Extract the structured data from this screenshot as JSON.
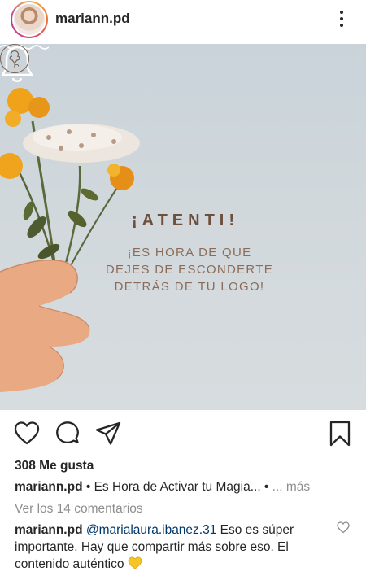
{
  "header": {
    "username": "mariann.pd",
    "more_icon": "more-vertical-icon"
  },
  "post": {
    "headline": "¡ATENTI!",
    "message_lines": [
      "¡ES HORA DE QUE",
      "DEJES DE ESCONDERTE",
      "DETRÁS DE TU LOGO!"
    ]
  },
  "actions": {
    "like_icon": "heart-outline-icon",
    "comment_icon": "comment-icon",
    "share_icon": "paper-plane-icon",
    "save_icon": "bookmark-icon"
  },
  "likes_text": "308 Me gusta",
  "caption": {
    "username": "mariann.pd",
    "text": " • Es Hora de Activar tu Magia... •",
    "more": " ... más"
  },
  "view_comments": "Ver los 14 comentarios",
  "comment": {
    "username": "mariann.pd",
    "mention": "@marialaura.ibanez.31",
    "text": " Eso es súper importante. Hay que compartir más sobre eso. El contenido auténtico",
    "emoji": "yellow-heart-icon",
    "like_icon": "heart-outline-small-icon"
  },
  "colors": {
    "accent_text": "#6e4f3c",
    "link": "#00376b",
    "muted": "#8e8e8e",
    "flower_orange": "#e9a21b"
  }
}
